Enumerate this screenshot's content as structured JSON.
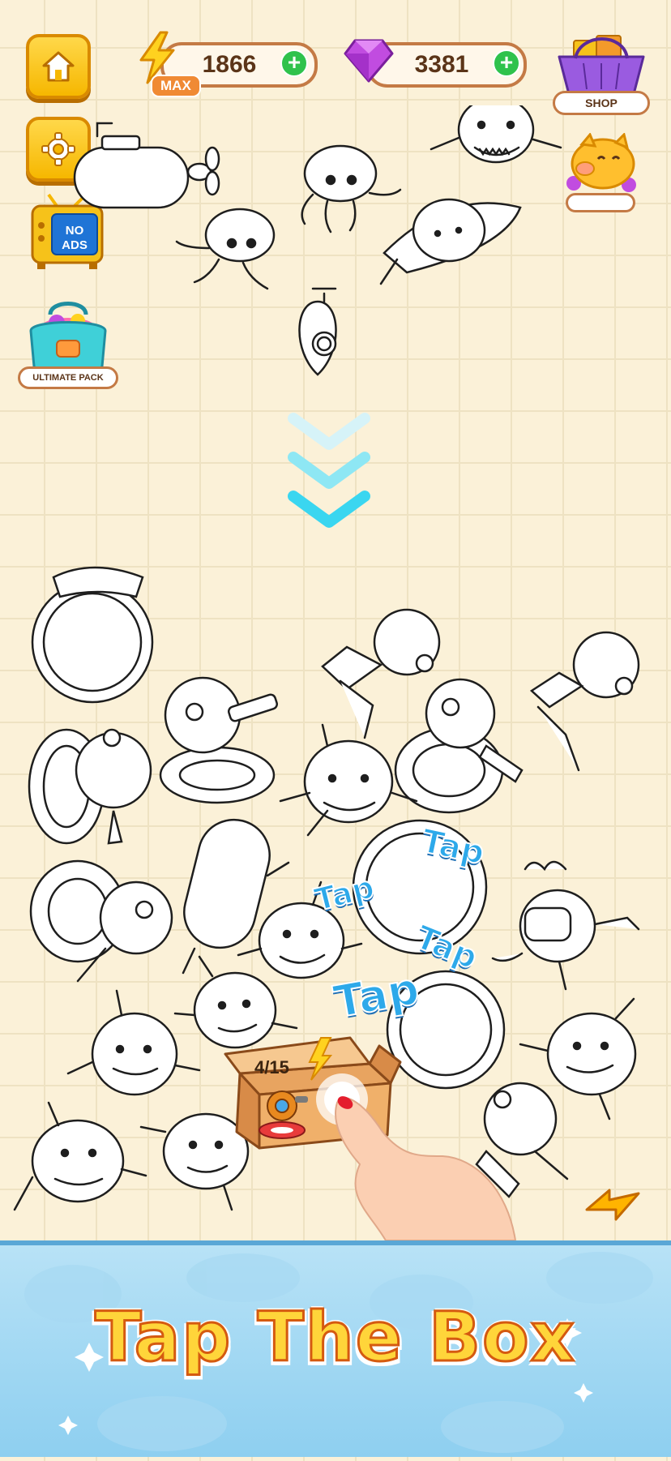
{
  "hud": {
    "energy_value": "1866",
    "energy_tag": "MAX",
    "gems_value": "3381",
    "plus_label": "+"
  },
  "side_buttons": {
    "shop_label": "SHOP",
    "no_ads_line1": "NO",
    "no_ads_line2": "ADS",
    "ultimate_pack_label": "ULTIMATE PACK"
  },
  "box": {
    "progress": "4/15",
    "current": 4,
    "total": 15
  },
  "hints": {
    "tap_words": [
      "Tap",
      "Tap",
      "Tap",
      "Tap"
    ]
  },
  "banner": {
    "title": "Tap The Box"
  },
  "colors": {
    "background": "#fbf1d8",
    "grid": "#eee2c2",
    "accent_yellow": "#f6b700",
    "arrow_cyan": "#3ad6f0",
    "tap_blue": "#2da9ea",
    "banner_blue": "#8ecff0",
    "title_yellow": "#ffd53a"
  },
  "icons": {
    "home": "home-icon",
    "settings": "gear-icon",
    "energy": "lightning-icon",
    "gem": "gem-icon",
    "shop": "basket-icon",
    "piggy": "piggy-bank-icon",
    "no_ads": "tv-icon",
    "pack": "bag-icon",
    "arrows": "chevron-down-icon",
    "skip": "lightning-arrow-icon"
  }
}
